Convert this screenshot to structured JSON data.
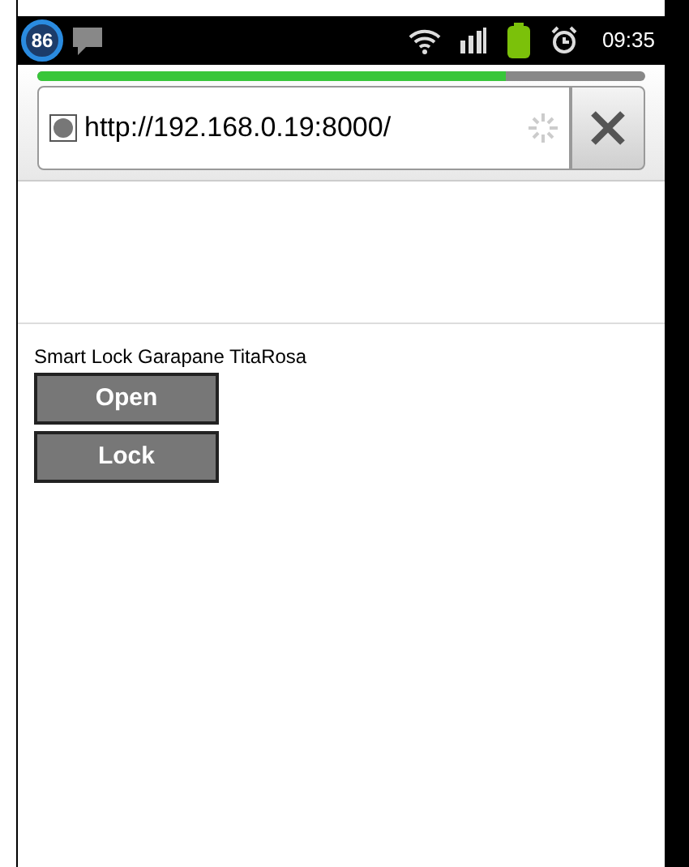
{
  "status_bar": {
    "badge": "86",
    "time": "09:35"
  },
  "browser": {
    "progress": {
      "level": 0.77
    },
    "url": "http://192.168.0.19:8000/"
  },
  "page": {
    "title": "Smart Lock Garapane TitaRosa",
    "buttons": [
      "Open",
      "Lock"
    ]
  }
}
